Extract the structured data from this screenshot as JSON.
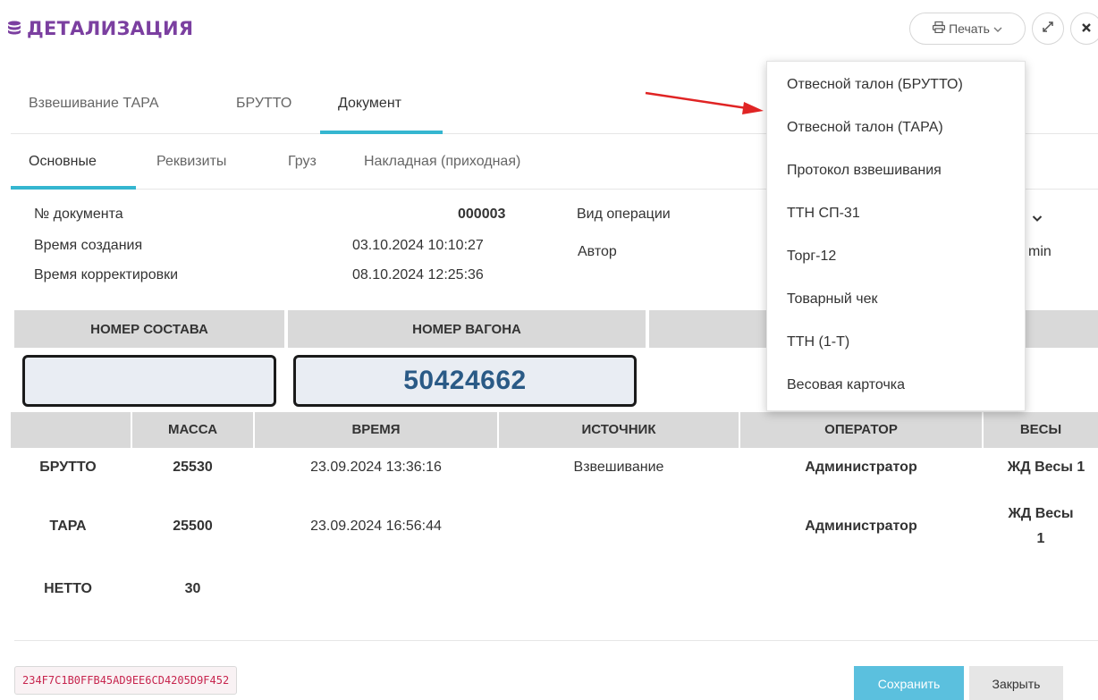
{
  "header": {
    "title": "ДЕТАЛИЗАЦИЯ",
    "title_icon": "database-icon",
    "print_label": "Печать",
    "accent_color": "#7b3fa0"
  },
  "tabs_top": [
    "Взвешивание ТАРА",
    "БРУТТО",
    "Документ"
  ],
  "tabs_top_active": "Документ",
  "tabs_sub": [
    "Основные",
    "Реквизиты",
    "Груз",
    "Накладная (приходная)"
  ],
  "tabs_sub_active": "Основные",
  "document": {
    "number_label": "№ документа",
    "number_value": "000003",
    "created_label": "Время создания",
    "created_value": "03.10.2024 10:10:27",
    "modified_label": "Время корректировки",
    "modified_value": "08.10.2024 12:25:36",
    "operation_label": "Вид операции",
    "author_label": "Автор",
    "author_value_partial": "min"
  },
  "composition": {
    "train_header": "НОМЕР СОСТАВА",
    "wagon_header": "НОМЕР ВАГОНА",
    "train_value": "",
    "wagon_value": "50424662"
  },
  "weighing_table": {
    "headers": [
      "",
      "МАССА",
      "ВРЕМЯ",
      "ИСТОЧНИК",
      "ОПЕРАТОР",
      "ВЕСЫ"
    ],
    "rows": [
      {
        "type": "БРУТТО",
        "mass": "25530",
        "time": "23.09.2024 13:36:16",
        "source": "Взвешивание",
        "operator": "Администратор",
        "scales": "ЖД Весы 1"
      },
      {
        "type": "ТАРА",
        "mass": "25500",
        "time": "23.09.2024 16:56:44",
        "source": "",
        "operator": "Администратор",
        "scales_line1": "ЖД Весы",
        "scales_line2": "1"
      },
      {
        "type": "НЕТТО",
        "mass": "30",
        "time": "",
        "source": "",
        "operator": "",
        "scales": ""
      }
    ]
  },
  "footer": {
    "hash": "234F7C1B0FFB45AD9EE6CD4205D9F452",
    "save_label": "Сохранить",
    "close_label": "Закрыть"
  },
  "print_menu": {
    "items": [
      "Отвесной талон (БРУТТО)",
      "Отвесной талон (ТАРА)",
      "Протокол взвешивания",
      "ТТН СП-31",
      "Торг-12",
      "Товарный чек",
      "ТТН (1-Т)",
      "Весовая карточка"
    ]
  }
}
